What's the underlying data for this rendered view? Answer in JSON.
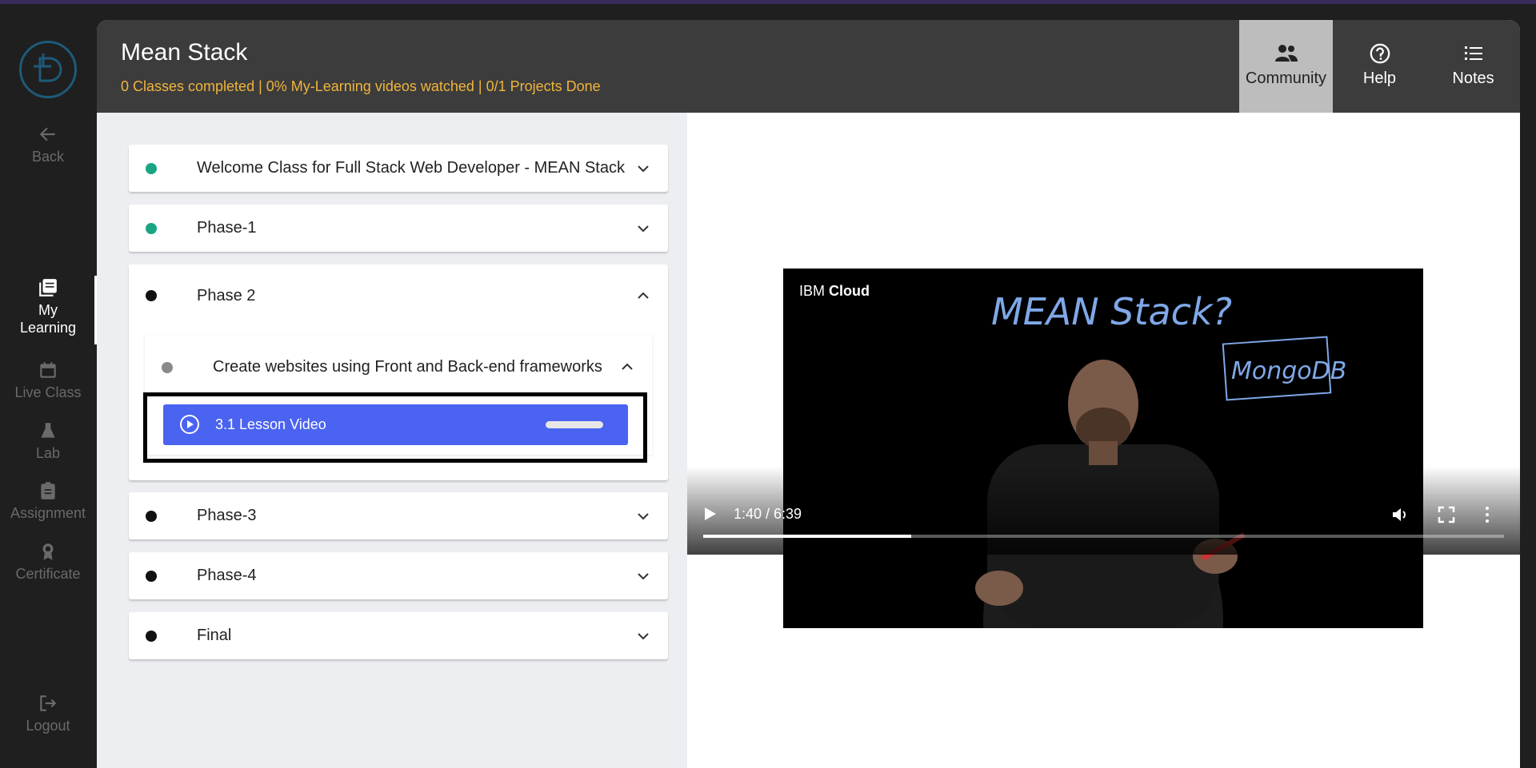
{
  "sidebar": {
    "items": [
      {
        "label": "Back",
        "icon": "arrow-left-icon"
      },
      {
        "label": "My Learning",
        "icon": "book-stack-icon",
        "active": true
      },
      {
        "label": "Live Class",
        "icon": "calendar-icon"
      },
      {
        "label": "Lab",
        "icon": "flask-icon"
      },
      {
        "label": "Assignment",
        "icon": "clipboard-icon"
      },
      {
        "label": "Certificate",
        "icon": "ribbon-icon"
      },
      {
        "label": "Logout",
        "icon": "logout-icon"
      }
    ]
  },
  "header": {
    "title": "Mean Stack",
    "progress": "0 Classes completed | 0% My-Learning videos watched | 0/1 Projects Done",
    "buttons": [
      {
        "label": "Community",
        "icon": "people-icon"
      },
      {
        "label": "Help",
        "icon": "help-circle-icon"
      },
      {
        "label": "Notes",
        "icon": "list-icon"
      }
    ]
  },
  "accordion": [
    {
      "title": "Welcome Class for Full Stack Web Developer - MEAN Stack",
      "status": "complete",
      "expanded": false
    },
    {
      "title": "Phase-1",
      "status": "complete",
      "expanded": false
    },
    {
      "title": "Phase 2",
      "status": "pending",
      "expanded": true,
      "sub": {
        "title": "Create websites using Front and Back-end frameworks",
        "expanded": true,
        "lesson": {
          "label": "3.1 Lesson Video"
        }
      }
    },
    {
      "title": "Phase-3",
      "status": "pending",
      "expanded": false
    },
    {
      "title": "Phase-4",
      "status": "pending",
      "expanded": false
    },
    {
      "title": "Final",
      "status": "pending",
      "expanded": false
    }
  ],
  "video": {
    "brand_light": "IBM ",
    "brand_bold": "Cloud",
    "board_title": "MEAN Stack?",
    "board_note": "MongoDB",
    "time": "1:40 / 6:39",
    "progress_fraction": 0.26
  },
  "colors": {
    "accent": "#4a63f0",
    "complete": "#1aa584",
    "progress_text": "#f0b43c",
    "header_bg": "#3c3c3c"
  }
}
